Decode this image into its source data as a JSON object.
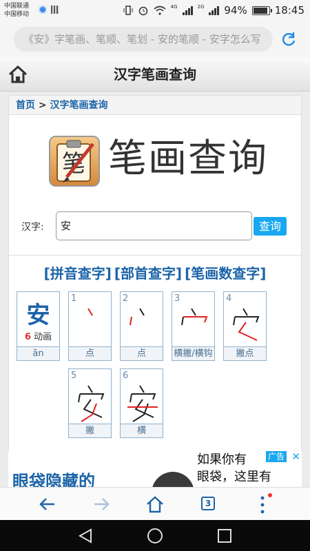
{
  "status": {
    "carrier1": "中国联通",
    "carrier2": "中国移动",
    "net1": "4G",
    "net2": "2G",
    "battery": "94%",
    "battery_level": 0.94,
    "time": "18:45"
  },
  "browser": {
    "url_text": "《安》字笔画、笔顺、笔划 - 安的笔顺 - 安字怎么写",
    "tab_count": "3"
  },
  "page": {
    "title": "汉字笔画查询",
    "breadcrumb_home": "首页",
    "breadcrumb_sep": ">",
    "breadcrumb_current": "汉字笔画查询",
    "big_title": "笔画查询",
    "logo_char": "笔",
    "query_label": "汉字:",
    "query_value": "安",
    "query_button": "查询",
    "link_pinyin": "[拼音查字]",
    "link_radical": "[部首查字]",
    "link_stroke_count": "[笔画数查字]"
  },
  "char_card": {
    "char": "安",
    "stroke_count": "6",
    "anim_label": "动画",
    "pinyin": "ān"
  },
  "strokes": [
    {
      "num": "1",
      "name": "点"
    },
    {
      "num": "2",
      "name": "点"
    },
    {
      "num": "3",
      "name": "横撇/横钩"
    },
    {
      "num": "4",
      "name": "撇点"
    },
    {
      "num": "5",
      "name": "撇"
    },
    {
      "num": "6",
      "name": "横"
    }
  ],
  "ad": {
    "left_text": "眼袋隐藏的",
    "right_line1": "如果你有",
    "right_line2": "眼袋，这里有",
    "tag": "广告",
    "close": "✕"
  }
}
